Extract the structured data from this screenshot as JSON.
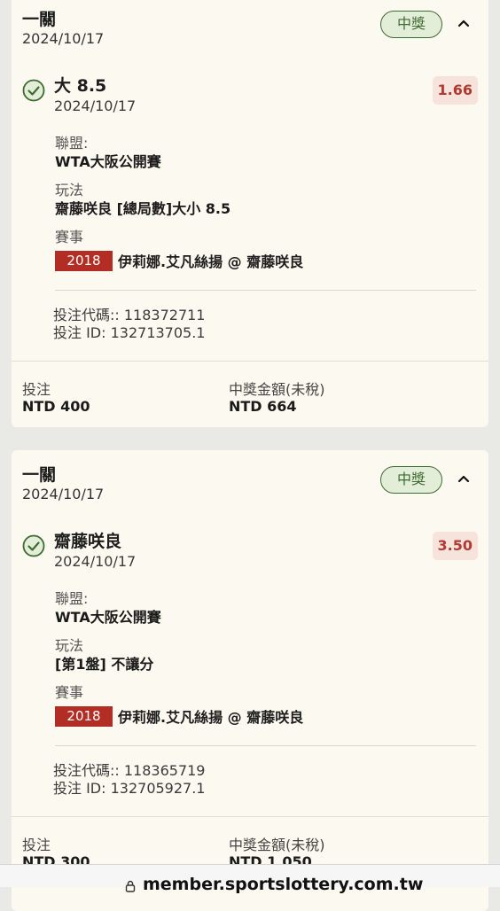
{
  "bets": [
    {
      "type": "一關",
      "date": "2024/10/17",
      "status": "中獎",
      "selection": "大 8.5",
      "selection_date": "2024/10/17",
      "odds": "1.66",
      "league_label": "聯盟:",
      "league": "WTA大阪公開賽",
      "market_label": "玩法",
      "market": "齋藤咲良 [總局數]大小 8.5",
      "event_label": "賽事",
      "event_code": "2018",
      "event": "伊莉娜.艾凡絲揚 @ 齋藤咲良",
      "bet_code": "投注代碼:: 118372711",
      "bet_id": "投注 ID: 132713705.1",
      "stake_label": "投注",
      "stake": "NTD 400",
      "payout_label": "中獎金額(未稅)",
      "payout": "NTD 664"
    },
    {
      "type": "一關",
      "date": "2024/10/17",
      "status": "中獎",
      "selection": "齋藤咲良",
      "selection_date": "2024/10/17",
      "odds": "3.50",
      "league_label": "聯盟:",
      "league": "WTA大阪公開賽",
      "market_label": "玩法",
      "market": "[第1盤] 不讓分",
      "event_label": "賽事",
      "event_code": "2018",
      "event": "伊莉娜.艾凡絲揚 @ 齋藤咲良",
      "bet_code": "投注代碼:: 118365719",
      "bet_id": "投注 ID: 132705927.1",
      "stake_label": "投注",
      "stake": "NTD 300",
      "payout_label": "中獎金額(未稅)",
      "payout": "NTD 1,050"
    }
  ],
  "browser": {
    "url": "member.sportslottery.com.tw"
  },
  "colors": {
    "win_green": "#3f6a32",
    "odds_red": "#b23a30",
    "event_tag_red": "#b22e24"
  },
  "icons": {
    "status": "check-circle-icon",
    "toggle": "chevron-up-icon",
    "lock": "lock-icon"
  }
}
